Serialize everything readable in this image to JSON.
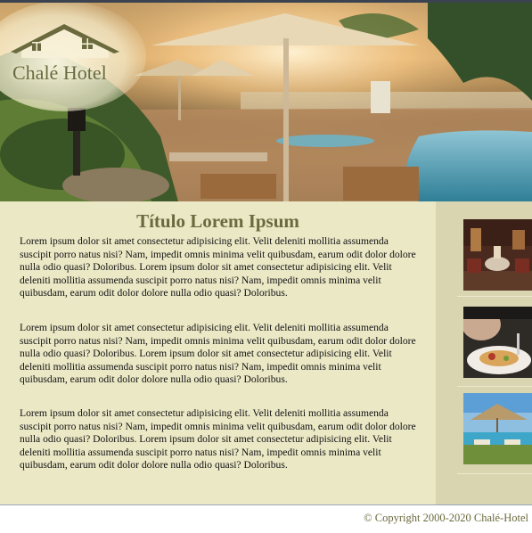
{
  "header": {
    "logo": {
      "text": "Chalé Hotel",
      "icon": "house-roof-logo"
    }
  },
  "main": {
    "title": "Título Lorem Ipsum",
    "paragraphs": [
      "Lorem ipsum dolor sit amet consectetur adipisicing elit. Velit deleniti mollitia assumenda suscipit porro natus nisi? Nam, impedit omnis minima velit quibusdam, earum odit dolor dolore nulla odio quasi? Doloribus. Lorem ipsum dolor sit amet consectetur adipisicing elit. Velit deleniti mollitia assumenda suscipit porro natus nisi? Nam, impedit omnis minima velit quibusdam, earum odit dolor dolore nulla odio quasi? Doloribus.",
      "Lorem ipsum dolor sit amet consectetur adipisicing elit. Velit deleniti mollitia assumenda suscipit porro natus nisi? Nam, impedit omnis minima velit quibusdam, earum odit dolor dolore nulla odio quasi? Doloribus. Lorem ipsum dolor sit amet consectetur adipisicing elit. Velit deleniti mollitia assumenda suscipit porro natus nisi? Nam, impedit omnis minima velit quibusdam, earum odit dolor dolore nulla odio quasi? Doloribus.",
      "Lorem ipsum dolor sit amet consectetur adipisicing elit. Velit deleniti mollitia assumenda suscipit porro natus nisi? Nam, impedit omnis minima velit quibusdam, earum odit dolor dolore nulla odio quasi? Doloribus. Lorem ipsum dolor sit amet consectetur adipisicing elit. Velit deleniti mollitia assumenda suscipit porro natus nisi? Nam, impedit omnis minima velit quibusdam, earum odit dolor dolore nulla odio quasi? Doloribus."
    ]
  },
  "sidebar": {
    "thumbnails": [
      "hotel-lobby-photo",
      "dining-plate-photo",
      "pool-umbrella-photo"
    ]
  },
  "footer": {
    "copyright": "© Copyright 2000-2020 Chalé-Hotel"
  },
  "colors": {
    "accent": "#6b6a3e",
    "content_bg": "#ebe8c6",
    "sidebar_bg": "#d8d5b0"
  }
}
